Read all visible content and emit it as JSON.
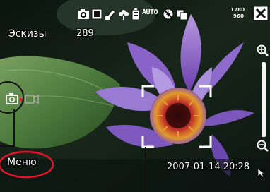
{
  "status_bar": {
    "icons": [
      "camera-mode-icon",
      "frame-icon",
      "pencil-ruler-icon",
      "macro-flower-icon",
      "battery-icon",
      "auto-iso-icon",
      "flash-off-icon",
      "burst-icon"
    ],
    "auto_label": "AUTO",
    "resolution_width": "1280",
    "resolution_height": "960"
  },
  "mode": {
    "label": "Эскизы",
    "count": "289"
  },
  "menu": {
    "label": "Меню"
  },
  "photo": {
    "timestamp": "2007-01-14  20:28"
  },
  "colors": {
    "background": "#0c1510",
    "text": "#ffffff",
    "callout": "#e0142a",
    "callout_line": "#111111"
  }
}
